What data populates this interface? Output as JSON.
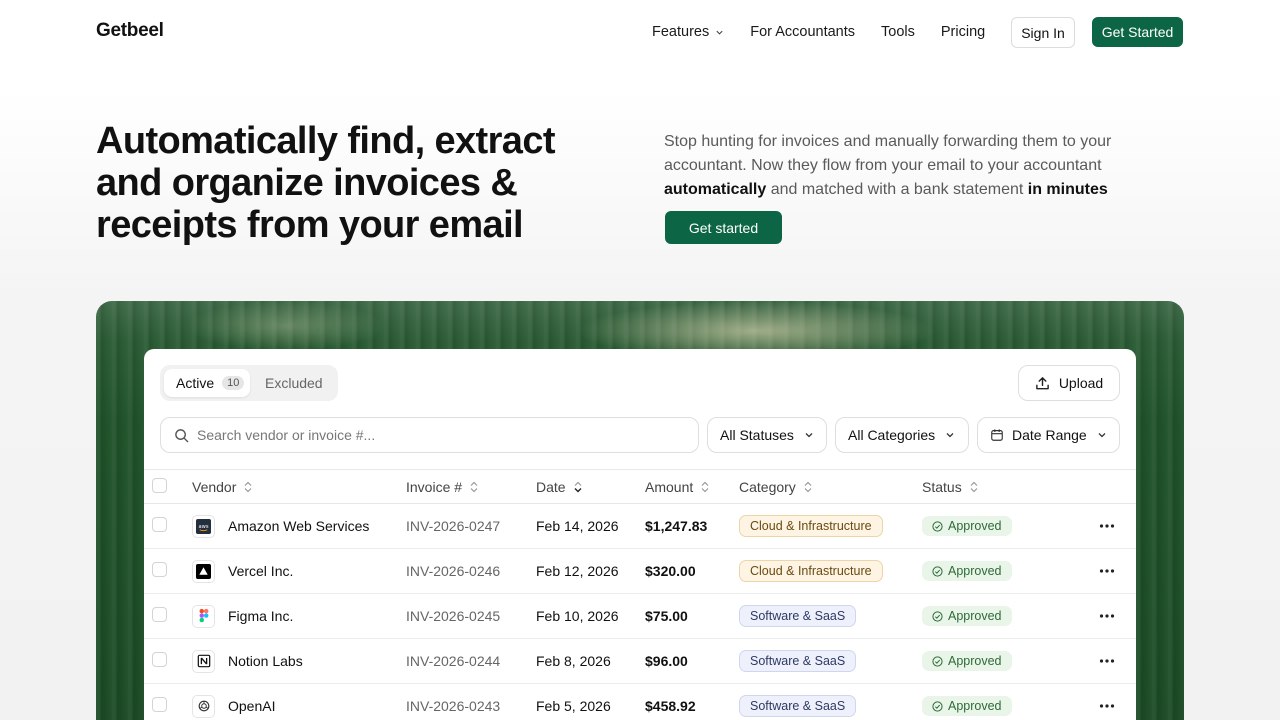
{
  "nav": {
    "logo": "Getbeel",
    "links": [
      {
        "label": "Features"
      },
      {
        "label": "For Accountants"
      },
      {
        "label": "Tools"
      },
      {
        "label": "Pricing"
      }
    ],
    "sign_in": "Sign In",
    "get_started": "Get Started"
  },
  "hero": {
    "title": "Automatically find, extract and organize invoices & receipts from your email",
    "desc_part1": "Stop hunting for invoices and manually forwarding them to your accountant. Now they flow from your email to your accountant ",
    "desc_bold1": "automatically",
    "desc_part2": " and matched with a bank statement ",
    "desc_bold2": "in minutes",
    "cta": "Get started"
  },
  "panel": {
    "tabs": {
      "active_label": "Active",
      "active_count": "10",
      "excluded_label": "Excluded"
    },
    "upload_label": "Upload",
    "search_placeholder": "Search vendor or invoice #...",
    "filters": {
      "statuses": "All Statuses",
      "categories": "All Categories",
      "date_range": "Date Range"
    },
    "columns": {
      "vendor": "Vendor",
      "invoice": "Invoice #",
      "date": "Date",
      "amount": "Amount",
      "category": "Category",
      "status": "Status"
    },
    "rows": [
      {
        "vendor": "Amazon Web Services",
        "icon": "aws-icon",
        "invoice": "INV-2026-0247",
        "date": "Feb 14, 2026",
        "amount": "$1,247.83",
        "category": "Cloud & Infrastructure",
        "status": "Approved"
      },
      {
        "vendor": "Vercel Inc.",
        "icon": "vercel-icon",
        "invoice": "INV-2026-0246",
        "date": "Feb 12, 2026",
        "amount": "$320.00",
        "category": "Cloud & Infrastructure",
        "status": "Approved"
      },
      {
        "vendor": "Figma Inc.",
        "icon": "figma-icon",
        "invoice": "INV-2026-0245",
        "date": "Feb 10, 2026",
        "amount": "$75.00",
        "category": "Software & SaaS",
        "status": "Approved"
      },
      {
        "vendor": "Notion Labs",
        "icon": "notion-icon",
        "invoice": "INV-2026-0244",
        "date": "Feb 8, 2026",
        "amount": "$96.00",
        "category": "Software & SaaS",
        "status": "Approved"
      },
      {
        "vendor": "OpenAI",
        "icon": "openai-icon",
        "invoice": "INV-2026-0243",
        "date": "Feb 5, 2026",
        "amount": "$458.92",
        "category": "Software & SaaS",
        "status": "Approved"
      }
    ]
  },
  "colors": {
    "brand_green": "#0c6645",
    "approved_bg": "#eaf5ea",
    "approved_text": "#2d6a36"
  }
}
